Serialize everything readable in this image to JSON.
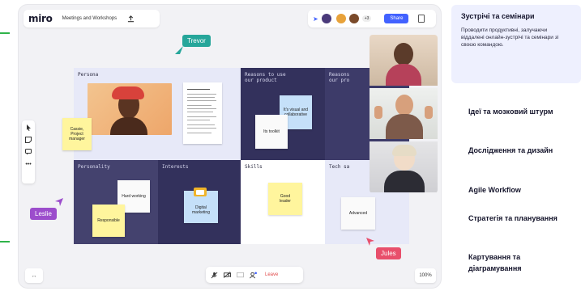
{
  "app": {
    "logo": "miro",
    "board_name": "Meetings and Workshops",
    "participants_extra": "+3",
    "share_label": "Share"
  },
  "colors": {
    "accent": "#4262ff",
    "sticky_yellow": "#fff59d",
    "sticky_blue": "#c5e0f9",
    "dark_cell": "#33315c",
    "light_cell": "#e7e9f8",
    "trevor_tag": "#26a69a",
    "leslie_tag": "#9c4dcc",
    "jules_tag": "#e84f6b",
    "leave_red": "#e04a4a"
  },
  "board": {
    "cells": {
      "persona": "Persona",
      "reasons_1": "Reasons to use\nour product",
      "reasons_2": "Reasons\nour pro",
      "personality": "Personality",
      "interests": "Interests",
      "skills": "Skills",
      "tech": "Tech sa"
    },
    "stickies": {
      "cassie": "Cassie,\nProject\nmanager",
      "visual": "It's visual and\ncollaborative",
      "toolkit": "Its toolkit",
      "hard_working": "Hard working",
      "responsible": "Responsible",
      "digital": "Digital\nmarketing",
      "good_leader": "Good\nleader",
      "advanced": "Advanced"
    },
    "cursors": {
      "trevor": "Trevor",
      "leslie": "Leslie",
      "jules": "Jules"
    }
  },
  "controls": {
    "leave_label": "Leave",
    "zoom": "100%"
  },
  "icons": [
    "upload-icon",
    "cursor-icon",
    "sticky-note-icon",
    "comment-icon",
    "more-icon",
    "mic-off-icon",
    "camera-off-icon",
    "screen-share-icon",
    "add-person-icon",
    "document-icon",
    "expand-icon"
  ],
  "sidebar": {
    "active": {
      "title": "Зустрічі та семінари",
      "description": "Проводити продуктивні, залучаючи віддалені онлайн-зустрічі та семінари зі своєю командою."
    },
    "items": [
      {
        "label": "Ідеї та мозковий штурм"
      },
      {
        "label": "Дослідження та дизайн"
      },
      {
        "label": "Agile Workflow"
      },
      {
        "label": "Стратегія та планування"
      },
      {
        "label": "Картування та діаграмування"
      }
    ]
  }
}
